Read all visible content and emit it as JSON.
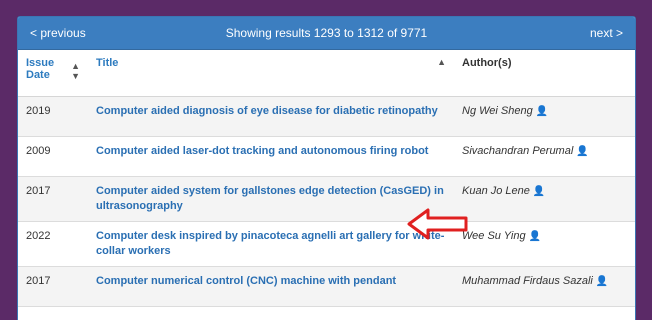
{
  "pager": {
    "previous_label": "< previous",
    "info": "Showing results 1293 to 1312 of 9771",
    "next_label": "next >"
  },
  "table": {
    "headers": {
      "date_line1": "Issue",
      "date_line2": "Date",
      "title": "Title",
      "author": "Author(s)"
    },
    "rows": [
      {
        "date": "2019",
        "title": "Computer aided diagnosis of eye disease for diabetic retinopathy",
        "author": "Ng Wei Sheng"
      },
      {
        "date": "2009",
        "title": "Computer aided laser-dot tracking and autonomous firing robot",
        "author": "Sivachandran Perumal"
      },
      {
        "date": "2017",
        "title": "Computer aided system for gallstones edge detection (CasGED) in ultrasonography",
        "author": "Kuan Jo Lene"
      },
      {
        "date": "2022",
        "title": "Computer desk inspired by pinacoteca agnelli art gallery for white-collar workers",
        "author": "Wee Su Ying"
      },
      {
        "date": "2017",
        "title": "Computer numerical control (CNC) machine with pendant",
        "author": "Muhammad Firdaus Sazali"
      }
    ]
  },
  "colors": {
    "background": "#5b2a67",
    "header_bar": "#3c7ec0",
    "link": "#2a6fb3",
    "arrow": "#e02020"
  },
  "icons": {
    "author": "user-icon",
    "sort": "sort-icon",
    "annotation": "arrow-left-icon"
  }
}
